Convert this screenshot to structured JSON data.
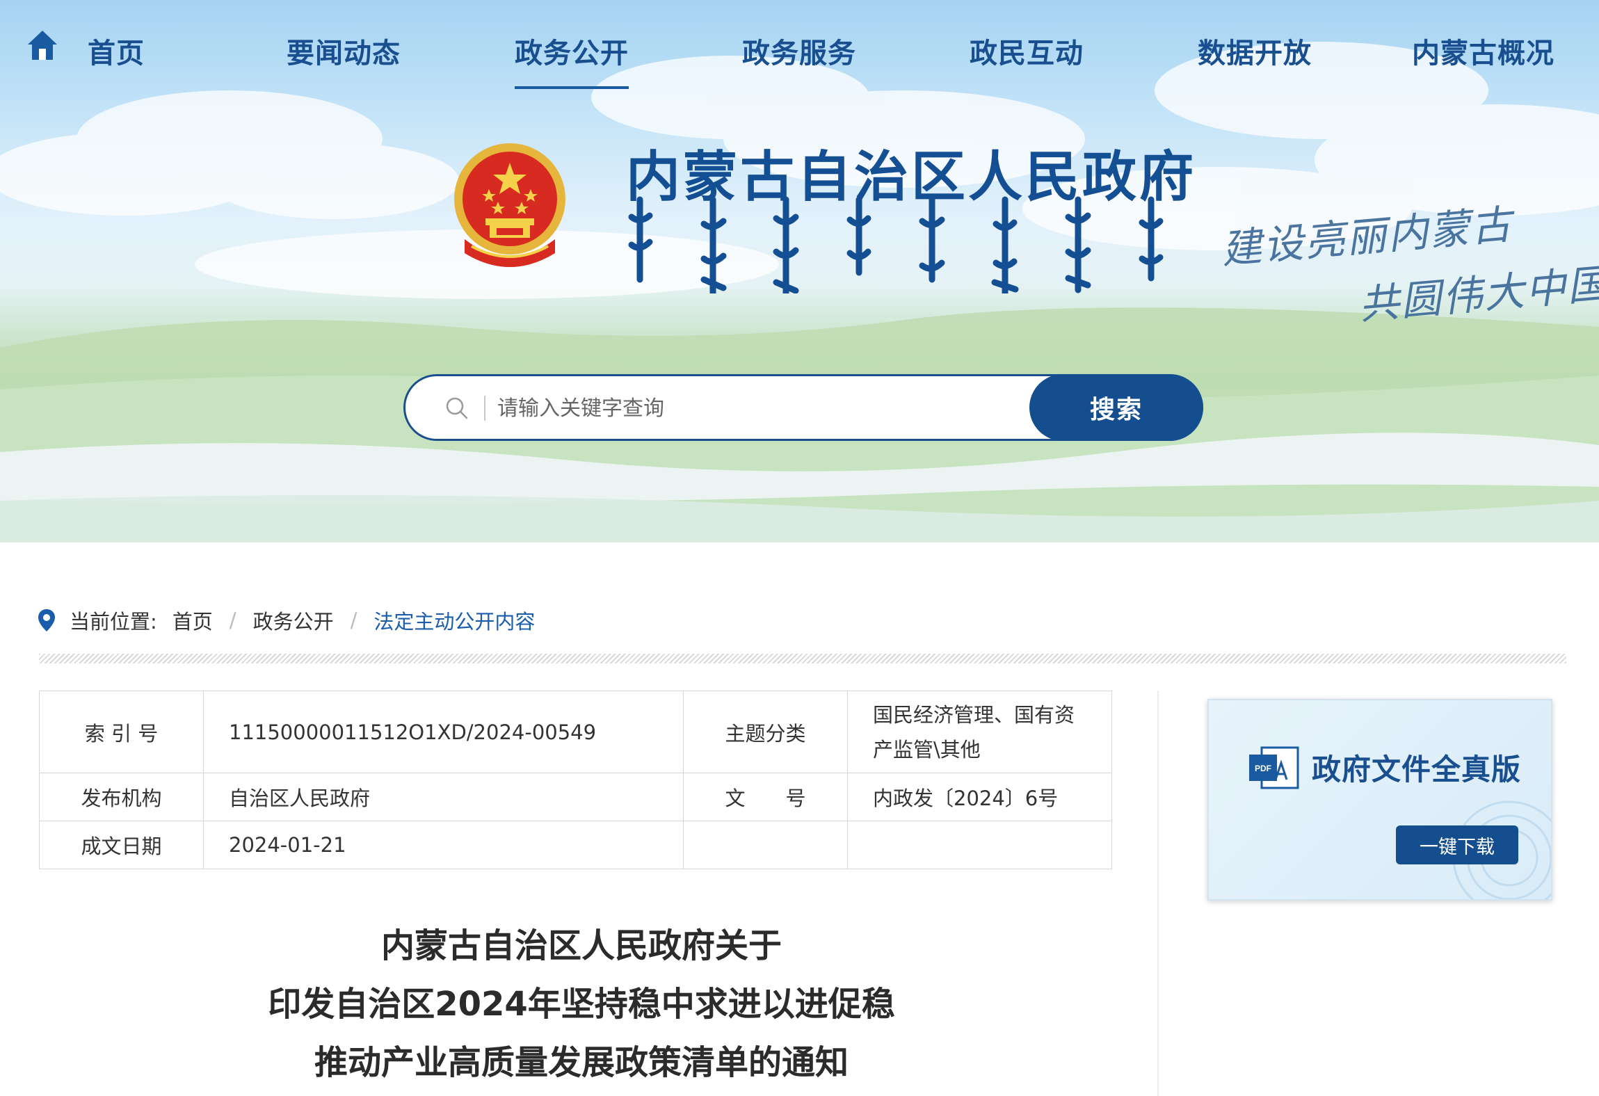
{
  "nav": {
    "items": [
      {
        "label": "首页"
      },
      {
        "label": "要闻动态"
      },
      {
        "label": "政务公开"
      },
      {
        "label": "政务服务"
      },
      {
        "label": "政民互动"
      },
      {
        "label": "数据开放"
      },
      {
        "label": "内蒙古概况"
      }
    ],
    "active_index": 2
  },
  "header": {
    "site_title": "内蒙古自治区人民政府",
    "slogan_line1": "建设亮丽内蒙古",
    "slogan_line2": "共圆伟大中国梦"
  },
  "search": {
    "placeholder": "请输入关键字查询",
    "button_label": "搜索"
  },
  "breadcrumb": {
    "label": "当前位置:",
    "items": [
      "首页",
      "政务公开",
      "法定主动公开内容"
    ]
  },
  "meta": {
    "index_label": "索 引 号",
    "index_value": "11150000011512O1XD/2024-00549",
    "topic_label": "主题分类",
    "topic_value_line1": "国民经济管理、国有资",
    "topic_value_line2": "产监管\\其他",
    "publisher_label": "发布机构",
    "publisher_value": "自治区人民政府",
    "docno_label": "文　　号",
    "docno_value": "内政发〔2024〕6号",
    "date_label": "成文日期",
    "date_value": "2024-01-21"
  },
  "pdf_card": {
    "icon_text": "PDF",
    "title": "政府文件全真版",
    "button_label": "一键下载"
  },
  "document": {
    "title_lines": [
      "内蒙古自治区人民政府关于",
      "印发自治区2024年坚持稳中求进以进促稳",
      "推动产业高质量发展政策清单的通知"
    ]
  },
  "colors": {
    "brand_blue": "#144e8f",
    "nav_blue": "#1a4f8f",
    "link_blue": "#1b5cab"
  }
}
